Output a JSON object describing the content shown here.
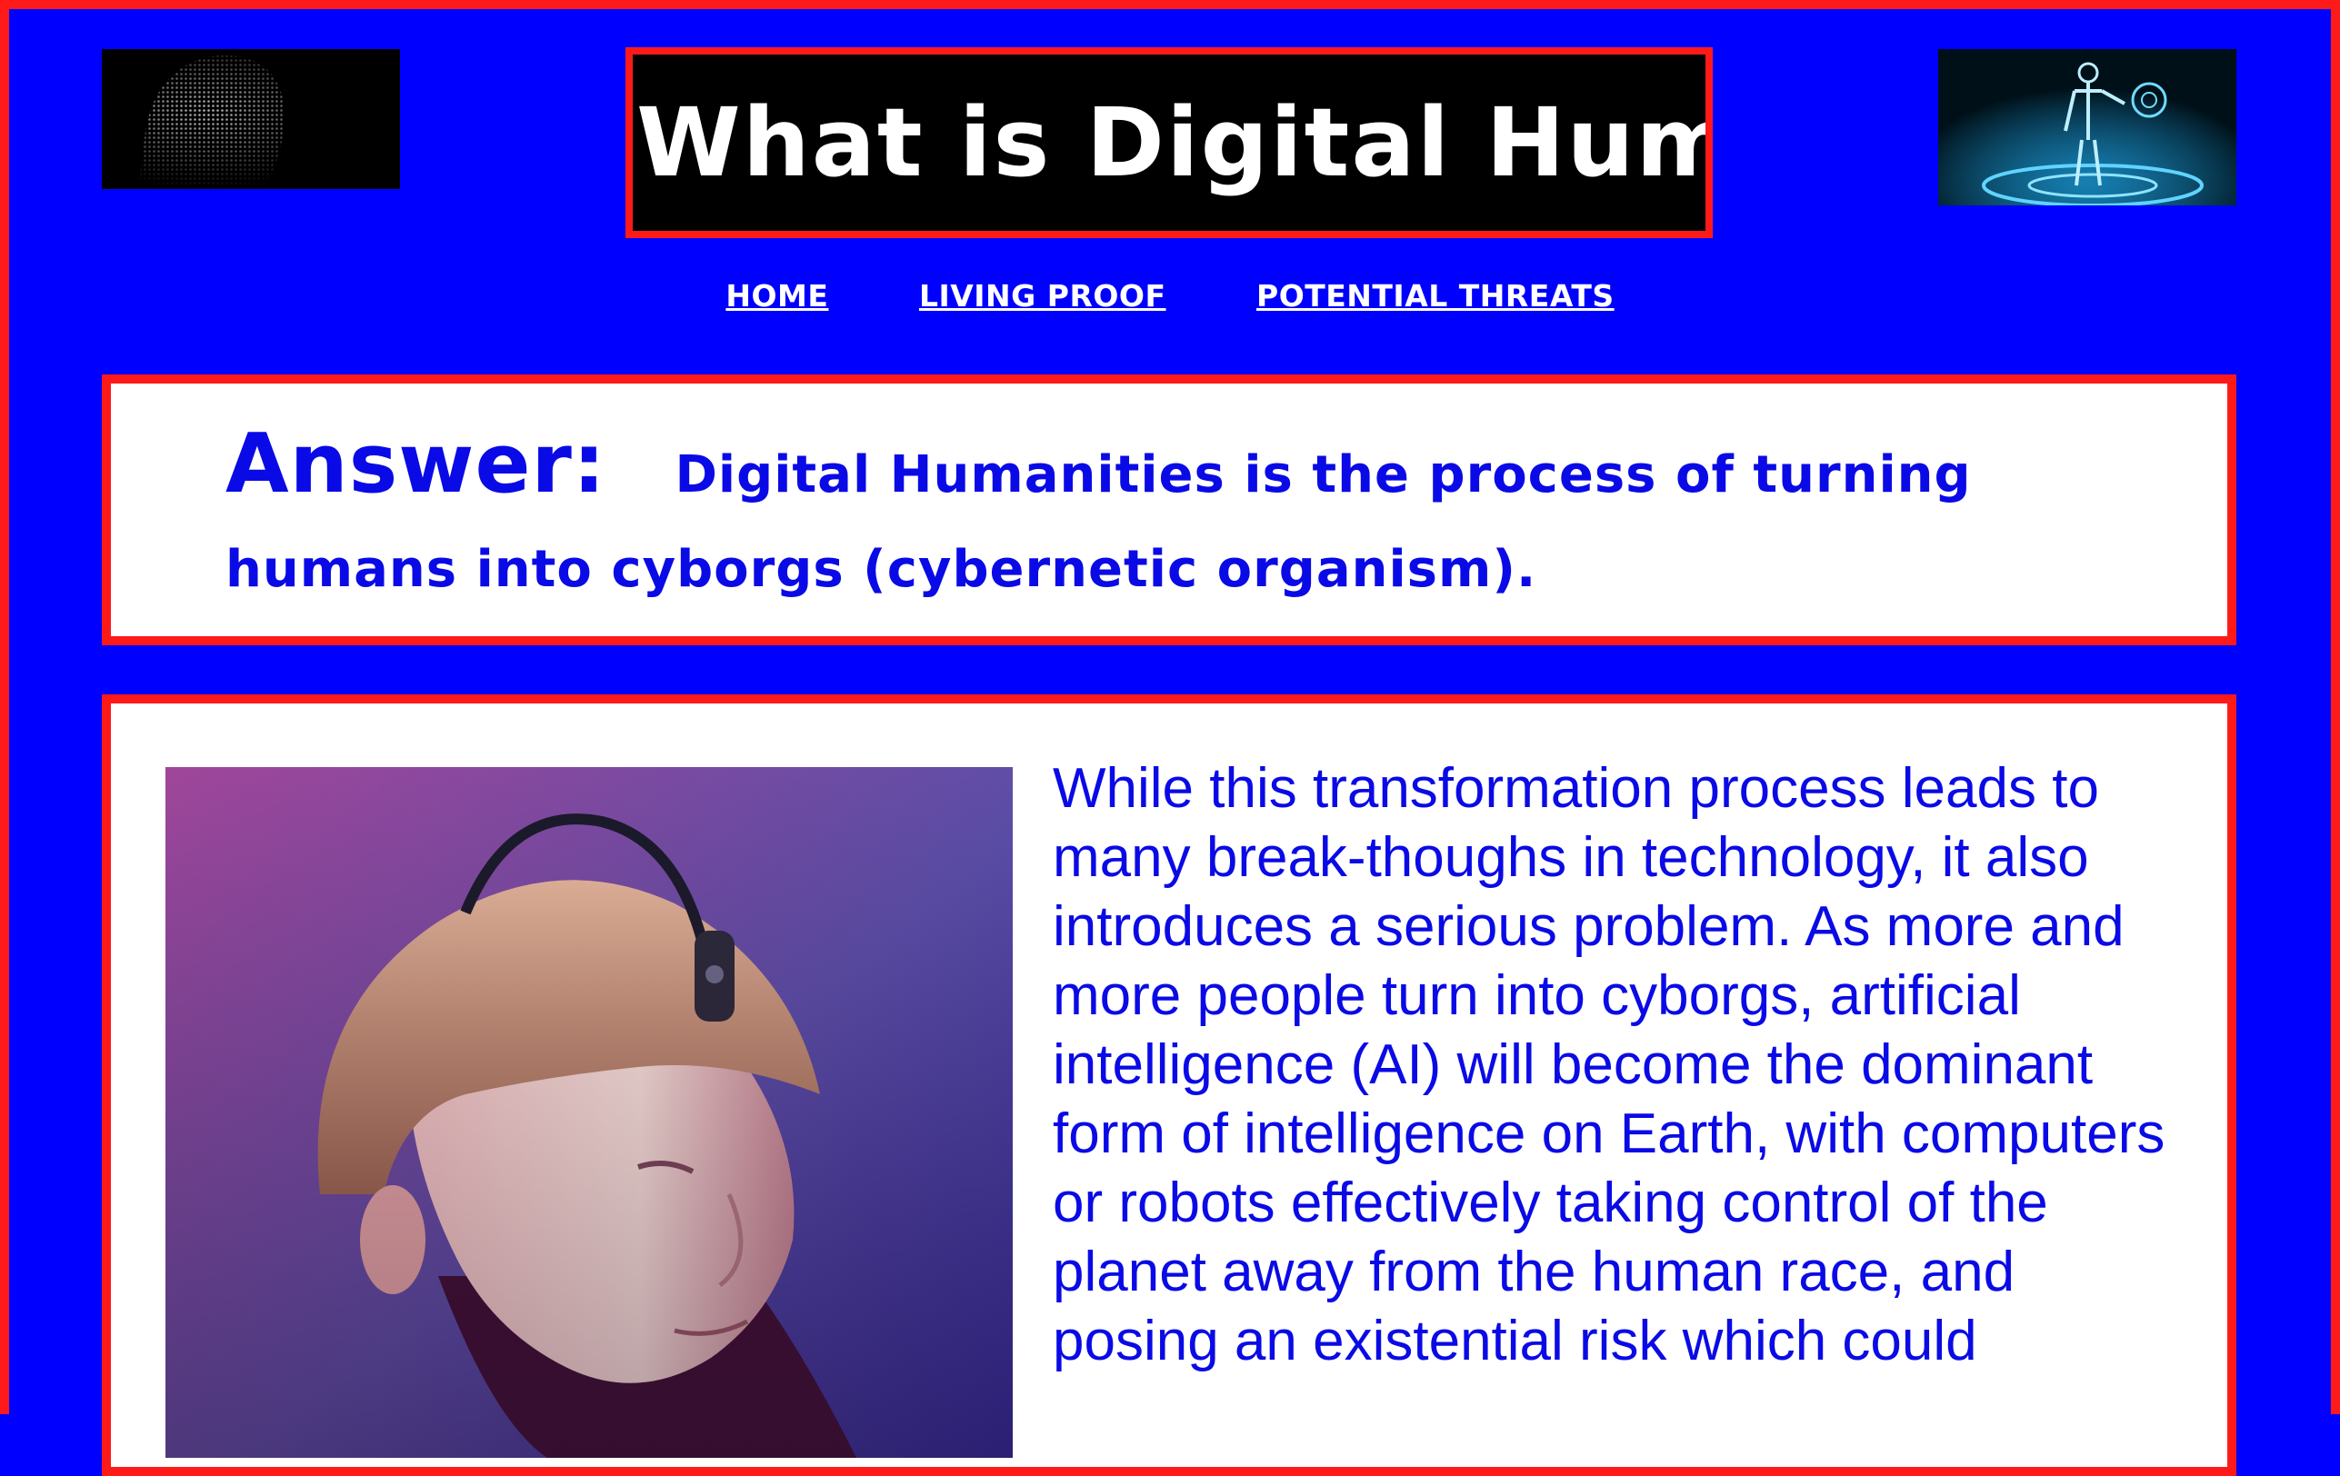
{
  "header": {
    "title": "What is Digital Human",
    "left_image": "face-wireframe-image",
    "right_image": "hologram-figure-image"
  },
  "nav": {
    "items": [
      {
        "label": "HOME"
      },
      {
        "label": "LIVING PROOF"
      },
      {
        "label": "POTENTIAL THREATS"
      }
    ]
  },
  "answer": {
    "label": "Answer:",
    "text": "Digital Humanities is the process of turning humans into cyborgs (cybernetic organism)."
  },
  "content": {
    "photo": "cyborg-antenna-portrait",
    "paragraph": "While this transformation process leads to many break-thoughs in technology, it also introduces a serious problem. As more and more people turn into cyborgs, artificial intelligence (AI) will become the dominant form of intelligence on Earth, with computers or robots effectively taking control of the planet away from the human race, and posing an existential risk which could"
  },
  "colors": {
    "background": "#0000ff",
    "border": "#ff1a1a",
    "text_blue": "#0a0ae6"
  }
}
